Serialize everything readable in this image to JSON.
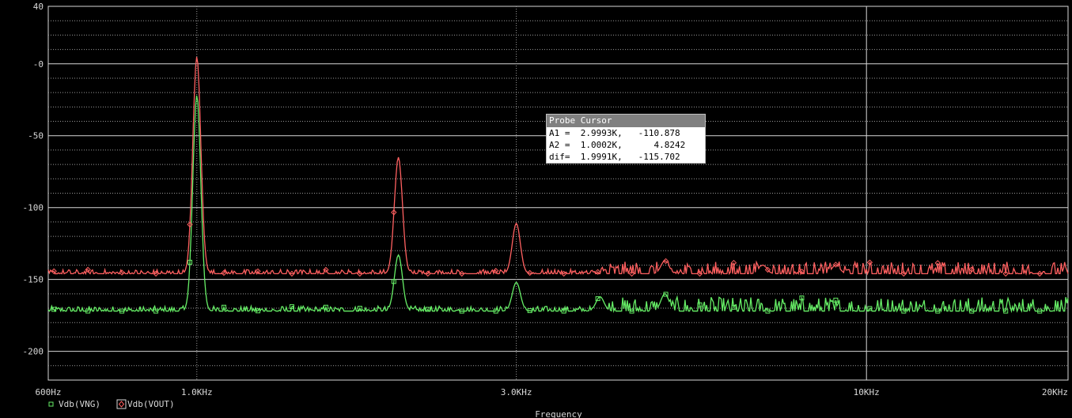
{
  "chart_data": {
    "type": "line",
    "xscale": "log",
    "xlim": [
      600,
      20000
    ],
    "ylim": [
      -220,
      40
    ],
    "xlabel": "Frequency",
    "ylabel": "",
    "grid": true,
    "x_ticks": [
      {
        "value": 600,
        "label": "600Hz"
      },
      {
        "value": 1000,
        "label": "1.0KHz"
      },
      {
        "value": 3000,
        "label": "3.0KHz"
      },
      {
        "value": 10000,
        "label": "10KHz"
      },
      {
        "value": 20000,
        "label": "20KHz"
      }
    ],
    "y_ticks": [
      {
        "value": 40,
        "label": "40"
      },
      {
        "value": 0,
        "label": "-0"
      },
      {
        "value": -50,
        "label": "-50"
      },
      {
        "value": -100,
        "label": "-100"
      },
      {
        "value": -150,
        "label": "-150"
      },
      {
        "value": -200,
        "label": "-200"
      }
    ],
    "series": [
      {
        "name": "Vdb(VNG)",
        "color": "#66ee66",
        "marker": "square",
        "floor": -172,
        "noise": 7,
        "peaks": [
          {
            "x": 1000,
            "y": -22
          },
          {
            "x": 2000,
            "y": -133
          },
          {
            "x": 3000,
            "y": -152
          },
          {
            "x": 4000,
            "y": -162
          },
          {
            "x": 5000,
            "y": -160
          }
        ]
      },
      {
        "name": "Vdb(VOUT)",
        "color": "#ff6060",
        "marker": "diamond",
        "floor": -146,
        "noise": 6,
        "peaks": [
          {
            "x": 1000,
            "y": 4.8242
          },
          {
            "x": 2000,
            "y": -65
          },
          {
            "x": 3000,
            "y": -111
          },
          {
            "x": 5000,
            "y": -137
          },
          {
            "x": 7000,
            "y": -140
          },
          {
            "x": 9000,
            "y": -140
          }
        ]
      }
    ]
  },
  "probe_cursor": {
    "title": "Probe Cursor",
    "rows": [
      {
        "label": "A1 =",
        "x": "2.9993K,",
        "y": "-110.878"
      },
      {
        "label": "A2 =",
        "x": "1.0002K,",
        "y": "4.8242"
      },
      {
        "label": "dif=",
        "x": "1.9991K,",
        "y": "-115.702"
      }
    ]
  },
  "colors": {
    "background": "#000000",
    "grid": "#d8d8d8",
    "text": "#d8d8d8"
  }
}
